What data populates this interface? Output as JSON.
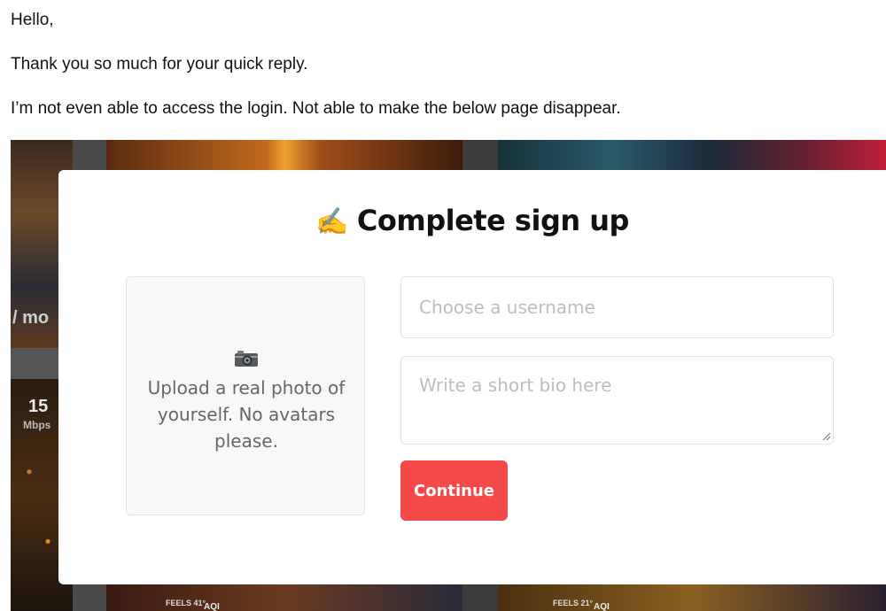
{
  "email": {
    "greeting": "Hello,",
    "line1": "Thank you so much for your quick reply.",
    "line2": "I’m not even able to access the login. Not able to make the below page disappear."
  },
  "background": {
    "partial_price": "/ mo",
    "speed_value": "15",
    "speed_unit": "Mbps",
    "feels_left": "FEELS 41°",
    "aqi_left": "AQI",
    "feels_right": "FEELS 21°",
    "aqi_right": "AQI"
  },
  "modal": {
    "title_icon": "✍️",
    "title": "Complete sign up",
    "upload": {
      "icon": "camera-icon",
      "text": "Upload a real photo of yourself. No avatars please."
    },
    "username": {
      "placeholder": "Choose a username",
      "value": ""
    },
    "bio": {
      "placeholder": "Write a short bio here",
      "value": ""
    },
    "continue_label": "Continue",
    "accent_color": "#f54848"
  }
}
